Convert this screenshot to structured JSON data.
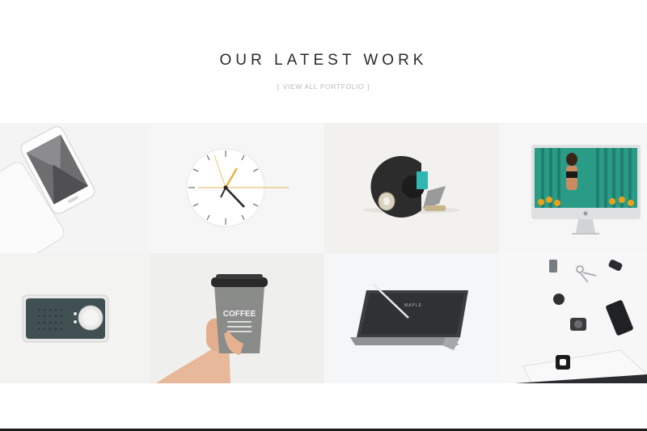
{
  "section": {
    "title": "OUR LATEST WORK",
    "view_all": "VIEW ALL PORTFOLIO",
    "bracket_open": "[",
    "bracket_close": "]"
  },
  "portfolio": {
    "tiles": [
      {
        "name": "phone-mockup"
      },
      {
        "name": "wall-clock"
      },
      {
        "name": "tape-dispenser"
      },
      {
        "name": "imac-mockup"
      },
      {
        "name": "radio-speaker"
      },
      {
        "name": "coffee-cup"
      },
      {
        "name": "tablet-keyboard"
      },
      {
        "name": "desk-flatlay"
      }
    ],
    "cup_text": "COFFEE",
    "tablet_brand": "MAPLE"
  },
  "colors": {
    "title": "#2a2a2a",
    "muted": "#b9b9b9",
    "tile_bg_light": "#f4f4f4",
    "tile_bg_warm": "#f1f0ee",
    "clock_hand_accent": "#f0a52a",
    "radio_body": "#3f4f52",
    "imac_screen": "#2a9b86"
  }
}
